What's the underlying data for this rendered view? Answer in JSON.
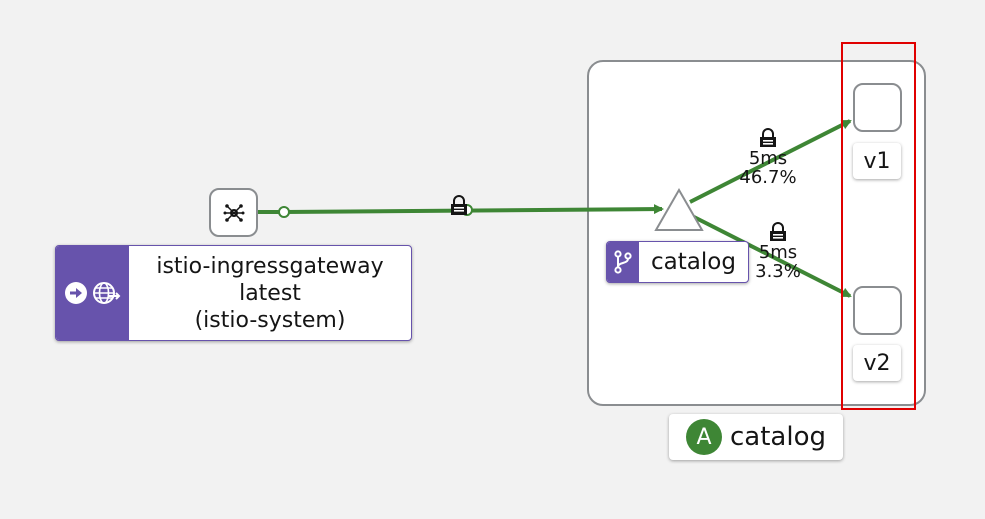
{
  "gateway": {
    "name": "istio-ingressgateway",
    "version": "latest",
    "namespace": "(istio-system)"
  },
  "service": {
    "name": "catalog"
  },
  "app": {
    "badge": "A",
    "name": "catalog"
  },
  "workloads": [
    {
      "label": "v1"
    },
    {
      "label": "v2"
    }
  ],
  "edges": {
    "to_v1": {
      "latency": "5ms",
      "percent": "46.7%"
    },
    "to_v2": {
      "latency": "5ms",
      "percent": "3.3%"
    }
  },
  "colors": {
    "edge": "#3e8635",
    "service_badge": "#6753ac",
    "app_badge": "#3e8635",
    "highlight": "#e00000"
  },
  "icons": {
    "gateway_node": "cluster-icon",
    "gateway_badge": "arrow-circle-right-icon",
    "gateway_globe": "globe-route-icon",
    "service_badge": "code-branch-icon",
    "mtls": "lock-icon"
  }
}
